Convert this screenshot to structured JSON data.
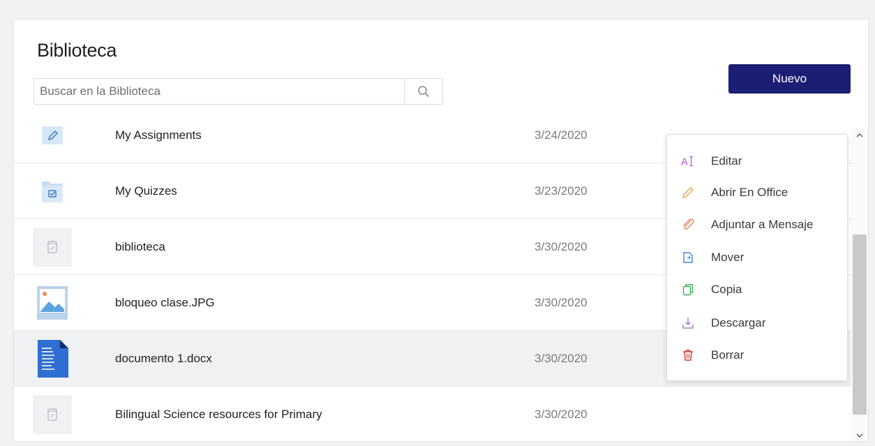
{
  "header": {
    "title": "Biblioteca",
    "new_button_label": "Nuevo"
  },
  "search": {
    "placeholder": "Buscar en la Biblioteca",
    "value": ""
  },
  "files": [
    {
      "name": "My Assignments",
      "date": "3/24/2020",
      "icon": "assignment-pencil-icon"
    },
    {
      "name": "My Quizzes",
      "date": "3/23/2020",
      "icon": "quiz-folder-icon"
    },
    {
      "name": "biblioteca",
      "date": "3/30/2020",
      "icon": "generic-file-icon"
    },
    {
      "name": "bloqueo clase.JPG",
      "date": "3/30/2020",
      "icon": "image-file-icon"
    },
    {
      "name": "documento 1.docx",
      "date": "3/30/2020",
      "icon": "word-document-icon"
    },
    {
      "name": "Bilingual Science resources for Primary",
      "date": "3/30/2020",
      "icon": "generic-file-icon"
    }
  ],
  "context_menu": {
    "items": [
      {
        "label": "Editar",
        "icon": "edit-text-icon",
        "color": "#b44fd1"
      },
      {
        "label": "Abrir En Office",
        "icon": "pencil-icon",
        "color": "#e9a24a"
      },
      {
        "label": "Adjuntar a Mensaje",
        "icon": "paperclip-icon",
        "color": "#e8845f"
      },
      {
        "label": "Mover",
        "icon": "move-icon",
        "color": "#3a86d6"
      },
      {
        "label": "Copia",
        "icon": "copy-icon",
        "color": "#3fae5a"
      },
      {
        "label": "Descargar",
        "icon": "download-icon",
        "color": "#9a7bd8"
      },
      {
        "label": "Borrar",
        "icon": "trash-icon",
        "color": "#d63a3a"
      }
    ]
  },
  "colors": {
    "primary_button": "#1c1e73",
    "selected_row": "#f0f1f3"
  }
}
